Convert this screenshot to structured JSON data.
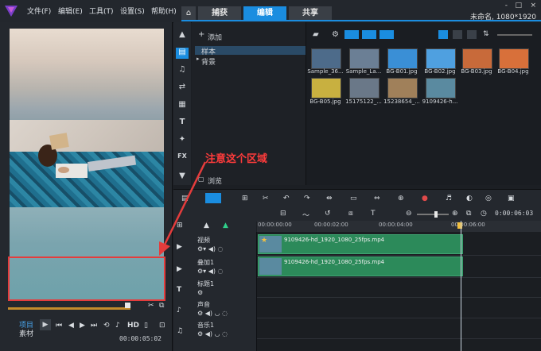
{
  "app": {
    "menu": [
      "文件(F)",
      "编辑(E)",
      "工具(T)",
      "设置(S)",
      "帮助(H)"
    ],
    "tabs": [
      {
        "label": "捕获",
        "active": false
      },
      {
        "label": "编辑",
        "active": true
      },
      {
        "label": "共享",
        "active": false
      }
    ],
    "project_name": "未命名, 1080*1920",
    "window_controls": [
      "-",
      "□",
      "×"
    ]
  },
  "library": {
    "add_label": "添加",
    "folders": [
      {
        "label": "样本",
        "selected": true
      },
      {
        "label": "背景",
        "selected": false
      }
    ],
    "browse_label": "浏览",
    "thumbnails": [
      {
        "label": "Sample_36...",
        "color": "#4d6b8a"
      },
      {
        "label": "Sample_La...",
        "color": "#6b7f95"
      },
      {
        "label": "BG-B01.jpg",
        "color": "#3a8fd6"
      },
      {
        "label": "BG-B02.jpg",
        "color": "#4fa0e0"
      },
      {
        "label": "BG-B03.jpg",
        "color": "#c86a3a"
      },
      {
        "label": "BG-B04.jpg",
        "color": "#d8703a"
      },
      {
        "label": "BG-B05.jpg",
        "color": "#c8b040"
      },
      {
        "label": "15175122_...",
        "color": "#6a7888"
      },
      {
        "label": "15238654_...",
        "color": "#a0805a"
      },
      {
        "label": "9109426-h...",
        "color": "#5a8aa0"
      }
    ]
  },
  "preview": {
    "project_label": "项目",
    "clip_label": "素材",
    "hd_label": "HD",
    "timecode": "00:00:05:02"
  },
  "timeline": {
    "timecode": "0:00:06:03",
    "ruler": [
      "00:00:00:00",
      "00:00:02:00",
      "00:00:04:00",
      "00:00:06:00"
    ],
    "tracks": [
      {
        "name": "视频",
        "clip": "9109426-hd_1920_1080_25fps.mp4"
      },
      {
        "name": "叠加1",
        "clip": "9109426-hd_1920_1080_25fps.mp4"
      },
      {
        "name": "标题1",
        "clip": ""
      },
      {
        "name": "声音",
        "clip": ""
      },
      {
        "name": "音乐1",
        "clip": ""
      }
    ]
  },
  "annotation": {
    "text": "注意这个区域",
    "color": "#e43c3c"
  }
}
